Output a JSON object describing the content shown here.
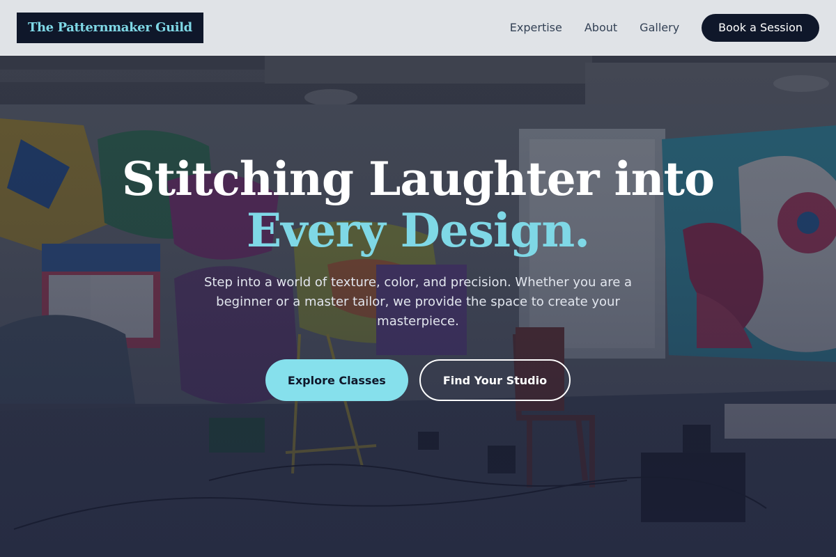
{
  "header": {
    "logo_text": "The Patternmaker Guild",
    "nav": [
      {
        "label": "Expertise"
      },
      {
        "label": "About"
      },
      {
        "label": "Gallery"
      }
    ],
    "cta_label": "Book a Session"
  },
  "hero": {
    "title_line1": "Stitching Laughter into",
    "title_line2": "Every Design.",
    "subtitle": "Step into a world of texture, color, and precision. Whether you are a beginner or a master tailor, we provide the space to create your masterpiece.",
    "primary_button": "Explore Classes",
    "secondary_button": "Find Your Studio",
    "background_image": "graffiti-art-studio"
  },
  "colors": {
    "accent": "#7fd8e6",
    "primary_button_bg": "#86e0ec",
    "dark": "#0f172a",
    "header_bg": "#eef0f3"
  }
}
